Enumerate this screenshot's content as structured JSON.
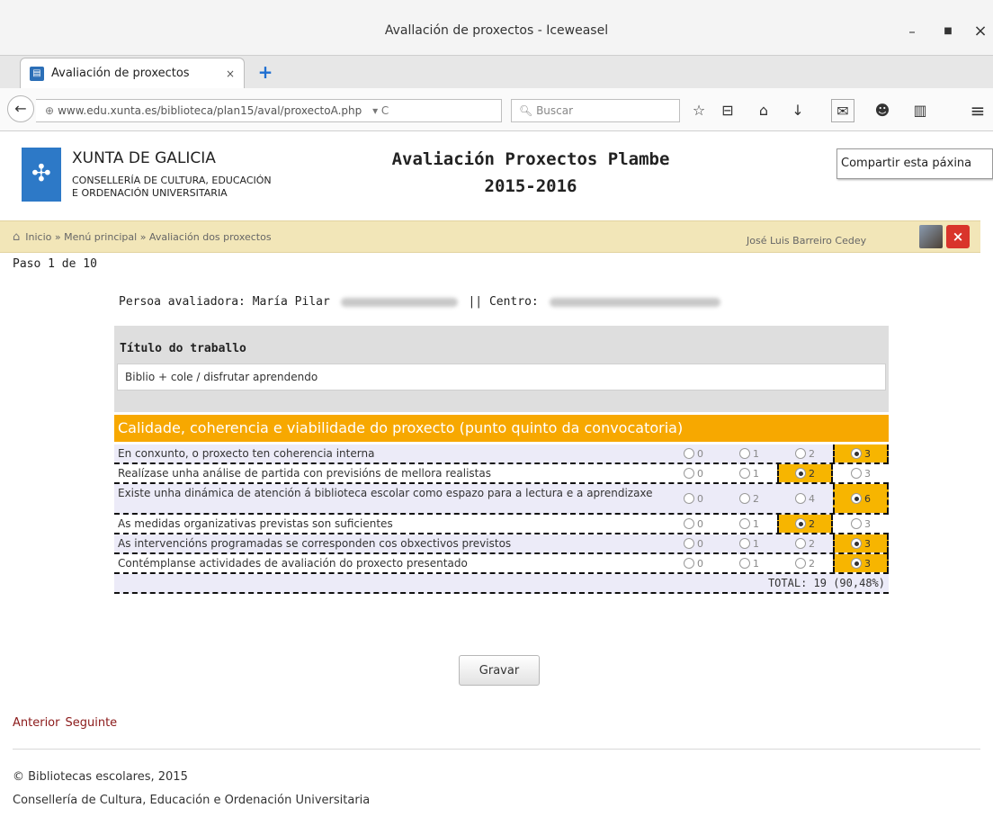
{
  "window": {
    "title": "Avallación de proxectos - Iceweasel",
    "minimize": "–",
    "maximize": "■",
    "close": "×"
  },
  "tab": {
    "label": "Avaliación de proxectos",
    "close": "×",
    "new_tab": "+"
  },
  "navbar": {
    "back": "←",
    "url": "www.edu.xunta.es/biblioteca/plan15/aval/proxectoA.php",
    "url_icons": "▾ C",
    "search_placeholder": "Buscar",
    "icons": [
      "☆",
      "⊟",
      "⌂",
      "↓",
      "✉",
      "☻",
      "▥",
      "≡"
    ]
  },
  "tooltip": "Compartir esta páxina",
  "header": {
    "org_name": "XUNTA DE GALICIA",
    "dept_line1": "CONSELLERÍA DE CULTURA, EDUCACIÓN",
    "dept_line2": "E ORDENACIÓN UNIVERSITARIA",
    "title_line1": "Avaliación Proxectos Plambe",
    "title_line2": "2015-2016"
  },
  "breadcrumb": {
    "home_icon": "⌂",
    "path": "Inicio » Menú principal » Avaliación dos proxectos",
    "user": "José Luis Barreiro Cedey",
    "logout": "×"
  },
  "page_counter": "Paso 1 de 10",
  "evaluator": {
    "label": "Persoa avaliadora: María Pilar",
    "centre_label": "|| Centro:"
  },
  "work": {
    "title_label": "Título do traballo",
    "title_value": "Biblio + cole / disfrutar aprendendo"
  },
  "section": {
    "heading": "Calidade, coherencia e viabilidade do proxecto (punto quinto da convocatoria)",
    "criteria": [
      {
        "text": "En conxunto, o proxecto ten coherencia interna",
        "options": [
          "0",
          "1",
          "2",
          "3"
        ],
        "selected": 3
      },
      {
        "text": "Realízase unha análise de partida con previsións de mellora realistas",
        "options": [
          "0",
          "1",
          "2",
          "3"
        ],
        "selected": 2
      },
      {
        "text": "Existe unha dinámica de atención á biblioteca escolar como espazo para a lectura e a aprendizaxe",
        "options": [
          "0",
          "2",
          "4",
          "6"
        ],
        "selected": 3
      },
      {
        "text": "As medidas organizativas previstas son suficientes",
        "options": [
          "0",
          "1",
          "2",
          "3"
        ],
        "selected": 2
      },
      {
        "text": "As intervencións programadas se corresponden cos obxectivos previstos",
        "options": [
          "0",
          "1",
          "2",
          "3"
        ],
        "selected": 3
      },
      {
        "text": "Contémplanse actividades de avaliación do proxecto presentado",
        "options": [
          "0",
          "1",
          "2",
          "3"
        ],
        "selected": 3
      }
    ],
    "total": "TOTAL: 19 (90,48%)"
  },
  "buttons": {
    "save": "Gravar",
    "previous": "Anterior",
    "next": "Seguinte"
  },
  "footer": {
    "line1": "© Bibliotecas escolares, 2015",
    "line2": "Consellería de Cultura, Educación e Ordenación Universitaria"
  }
}
